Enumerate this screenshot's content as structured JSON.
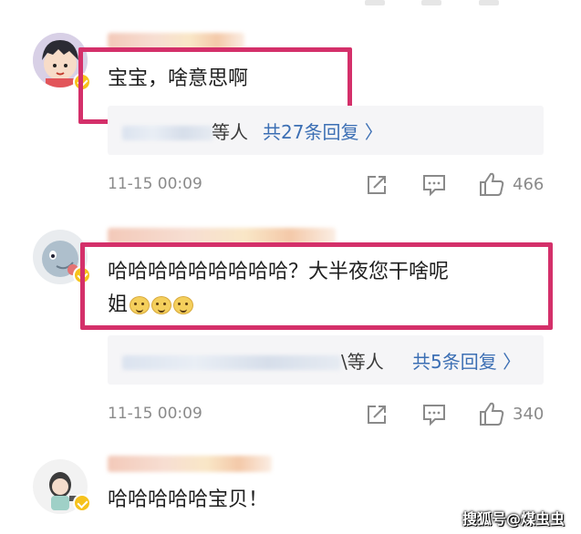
{
  "comments": [
    {
      "text": "宝宝，啥意思啊",
      "reply_suffix": "等人",
      "reply_link": "共27条回复 〉",
      "time": "11-15 00:09",
      "likes": "466"
    },
    {
      "text": "哈哈哈哈哈哈哈哈哈？大半夜您干啥呢",
      "text_line2": "姐",
      "reply_suffix": "\\等人",
      "reply_link": "共5条回复 〉",
      "time": "11-15 00:09",
      "likes": "340"
    },
    {
      "text": "哈哈哈哈哈宝贝！"
    }
  ],
  "watermark": "搜狐号@煤虫虫",
  "colors": {
    "highlight": "#d4306a",
    "link": "#3c6fb4",
    "verified_badge": "#f6c21c"
  },
  "icons": [
    "share-icon",
    "comment-icon",
    "like-icon"
  ]
}
